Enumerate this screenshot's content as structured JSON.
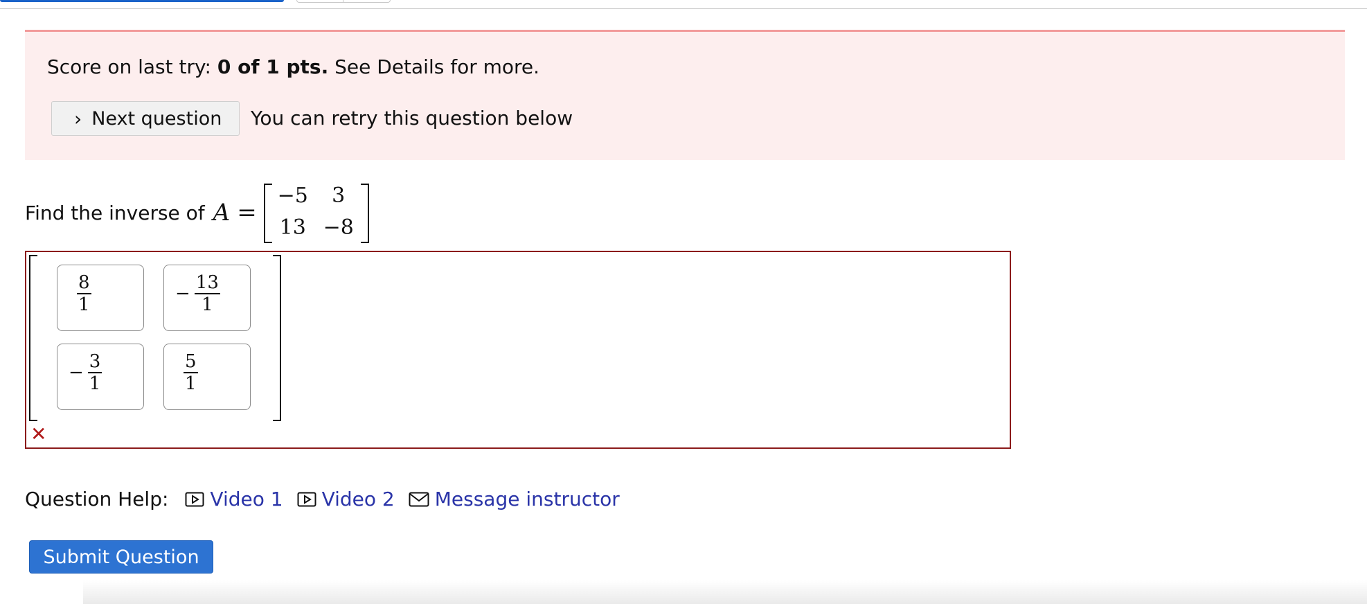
{
  "alert": {
    "score_prefix": "Score on last try: ",
    "score_value": "0 of 1 pts.",
    "score_suffix": " See Details for more.",
    "next_label": "Next question",
    "retry_text": "You can retry this question below"
  },
  "question": {
    "prompt": "Find the inverse of ",
    "variable": "A",
    "equals": "=",
    "matrix": [
      [
        "−5",
        "3"
      ],
      [
        "13",
        "−8"
      ]
    ]
  },
  "answer": {
    "cells": [
      {
        "neg": "",
        "num": "8",
        "den": "1"
      },
      {
        "neg": "−",
        "num": "13",
        "den": "1"
      },
      {
        "neg": "−",
        "num": "3",
        "den": "1"
      },
      {
        "neg": "",
        "num": "5",
        "den": "1"
      }
    ],
    "incorrect_mark": "✕"
  },
  "help": {
    "label": "Question Help:",
    "video1": "Video 1",
    "video2": "Video 2",
    "message": "Message instructor"
  },
  "submit_label": "Submit Question",
  "colors": {
    "alert_bg": "#fdeeee",
    "alert_border": "#f29b9b",
    "error": "#8b1a1a",
    "link": "#2a34a8",
    "primary": "#2d73d2"
  }
}
